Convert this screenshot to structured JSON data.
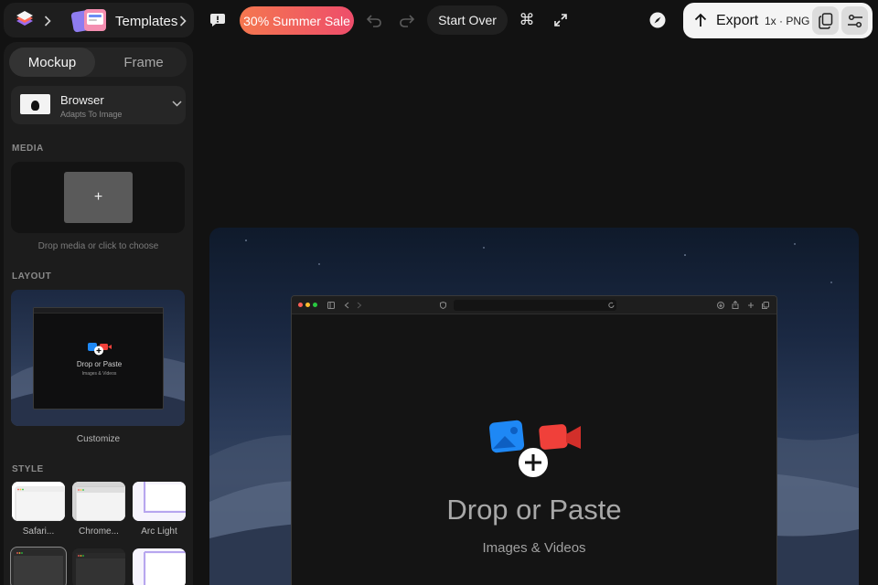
{
  "header": {
    "templates_label": "Templates",
    "sale_label": "30% Summer Sale",
    "start_over_label": "Start Over",
    "export_label": "Export",
    "export_scale": "1x · PNG",
    "icons": [
      "app-logo-icon",
      "chevron-right-icon",
      "templates-icon",
      "feedback-icon",
      "undo-icon",
      "redo-icon",
      "command-icon",
      "expand-icon",
      "compass-icon",
      "export-arrow-icon",
      "copy-icon",
      "settings-sliders-icon"
    ]
  },
  "sidebar": {
    "tabs": [
      {
        "label": "Mockup",
        "active": true
      },
      {
        "label": "Frame",
        "active": false
      }
    ],
    "device": {
      "name": "Browser",
      "subtitle": "Adapts To Image"
    },
    "media": {
      "section_label": "MEDIA",
      "add_glyph": "+",
      "hint": "Drop media or click to choose"
    },
    "layout": {
      "section_label": "LAYOUT",
      "preview_title": "Drop or Paste",
      "preview_subtitle": "Images & Videos",
      "caption": "Customize"
    },
    "style": {
      "section_label": "STYLE",
      "items": [
        {
          "label": "Safari..."
        },
        {
          "label": "Chrome..."
        },
        {
          "label": "Arc Light"
        },
        {
          "label": ""
        },
        {
          "label": ""
        },
        {
          "label": ""
        }
      ]
    }
  },
  "canvas": {
    "drop_title": "Drop or Paste",
    "drop_subtitle": "Images & Videos",
    "colors": {
      "traffic_red": "#ff5f57",
      "traffic_yellow": "#febc2e",
      "traffic_green": "#28c840",
      "image_icon_blue": "#1e88f5",
      "video_icon_red": "#f0403a",
      "sale_gradient_start": "#f4774f",
      "sale_gradient_end": "#ee4d6b"
    }
  }
}
